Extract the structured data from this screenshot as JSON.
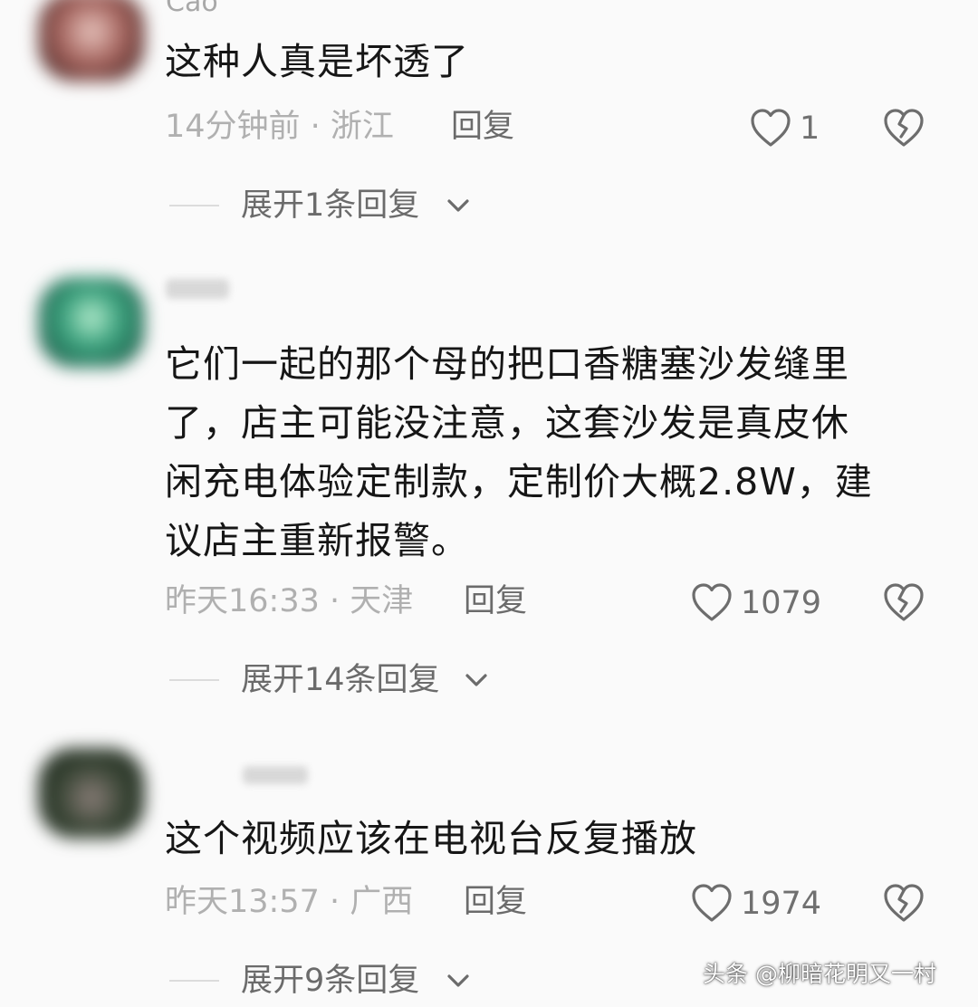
{
  "comments": [
    {
      "username": "Cao",
      "text": "这种人真是坏透了",
      "meta": "14分钟前 · 浙江",
      "reply_label": "回复",
      "likes": "1",
      "expand_label": "展开1条回复",
      "avatar_color": "#8a5a55"
    },
    {
      "username": "",
      "text_lines": [
        "它们一起的那个母的把口香糖塞沙发缝里",
        "了，店主可能没注意，这套沙发是真皮休",
        "闲充电体验定制款，定制价大概2.8W，建",
        "议店主重新报警。"
      ],
      "meta": "昨天16:33 · 天津",
      "reply_label": "回复",
      "likes": "1079",
      "expand_label": "展开14条回复",
      "avatar_color": "#2f8a6a"
    },
    {
      "username": "",
      "text": "这个视频应该在电视台反复播放",
      "meta": "昨天13:57 · 广西",
      "reply_label": "回复",
      "likes": "1974",
      "expand_label": "展开9条回复",
      "avatar_color": "#3c4a3a"
    }
  ],
  "icons": {
    "like": "heart-outline-icon",
    "dislike": "broken-heart-icon",
    "expand": "chevron-down-icon"
  },
  "watermark": "头条 @柳暗花明又一村"
}
